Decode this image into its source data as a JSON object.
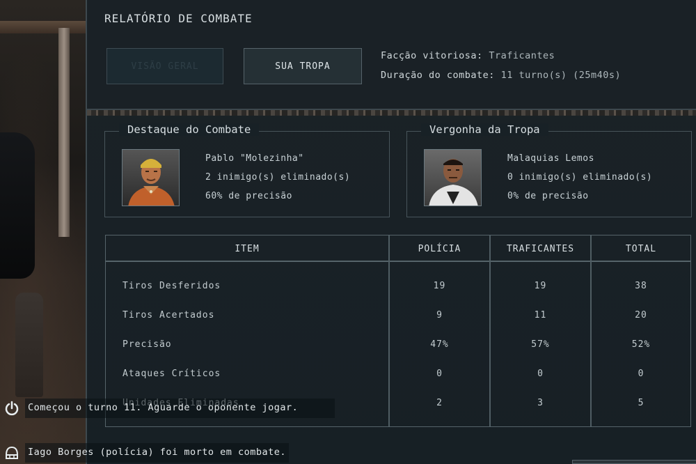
{
  "header": {
    "title": "RELATÓRIO DE COMBATE",
    "tabs": [
      {
        "label": "VISÃO GERAL",
        "state": "disabled"
      },
      {
        "label": "SUA TROPA",
        "state": "active"
      }
    ],
    "summary": {
      "faction_label": "Facção vitoriosa:",
      "faction_value": "Traficantes",
      "duration_label": "Duração do combate:",
      "duration_value": "11 turno(s) (25m40s)"
    }
  },
  "highlights": {
    "best": {
      "title": "Destaque do Combate",
      "name": "Pablo \"Molezinha\"",
      "kills": "2 inimigo(s) eliminado(s)",
      "accuracy": "60% de precisão",
      "portrait_icon": "soldier-portrait-icon"
    },
    "worst": {
      "title": "Vergonha da Tropa",
      "name": "Malaquias Lemos",
      "kills": "0 inimigo(s) eliminado(s)",
      "accuracy": "0% de precisão",
      "portrait_icon": "soldier-portrait-icon"
    }
  },
  "table": {
    "headers": [
      "ITEM",
      "POLÍCIA",
      "TRAFICANTES",
      "TOTAL"
    ],
    "rows": [
      {
        "item": "Tiros Desferidos",
        "policia": "19",
        "traficantes": "19",
        "total": "38"
      },
      {
        "item": "Tiros Acertados",
        "policia": "9",
        "traficantes": "11",
        "total": "20"
      },
      {
        "item": "Precisão",
        "policia": "47%",
        "traficantes": "57%",
        "total": "52%"
      },
      {
        "item": "Ataques Críticos",
        "policia": "0",
        "traficantes": "0",
        "total": "0"
      },
      {
        "item": "Unidades Eliminadas",
        "policia": "2",
        "traficantes": "3",
        "total": "5"
      }
    ]
  },
  "chat": {
    "messages": [
      {
        "icon": "power-icon",
        "text": "Começou o turno 11. Aguarde o oponente jogar."
      },
      {
        "icon": "helmet-icon",
        "text": "Iago Borges (polícia) foi morto em combate."
      }
    ]
  },
  "colors": {
    "panel_bg": "#1a2126",
    "border": "#56646a",
    "text": "#c9d2d6"
  }
}
